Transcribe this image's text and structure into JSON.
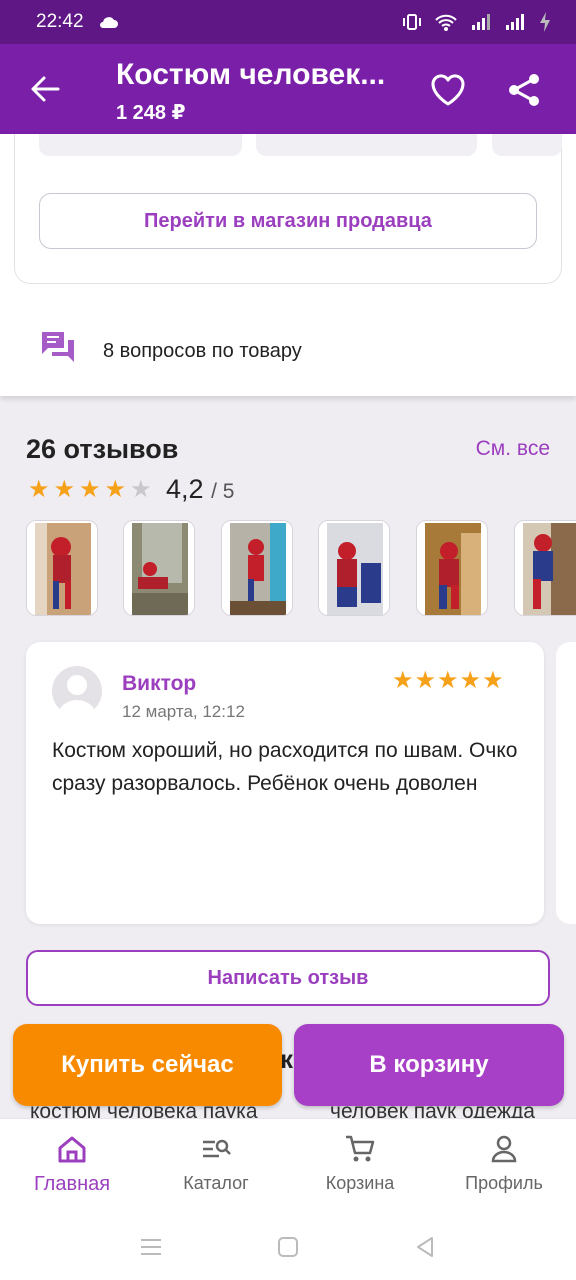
{
  "status_bar": {
    "time": "22:42"
  },
  "app_bar": {
    "title": "Костюм человек...",
    "price": "1 248 ₽"
  },
  "shop": {
    "button_label": "Перейти в магазин продавца"
  },
  "questions": {
    "label": "8 вопросов по товару"
  },
  "reviews": {
    "title": "26 отзывов",
    "see_all": "См. все",
    "rating": "4,2",
    "rating_of": "/ 5",
    "stars_filled": 4,
    "stars_total": 5
  },
  "review": {
    "author": "Виктор",
    "date": "12 марта, 12:12",
    "stars": "★★★★★",
    "text": "Костюм хороший, но расходится по швам. Очко сразу разорвалось. Ребёнок очень доволен"
  },
  "write_review": "Написать отзыв",
  "behind": {
    "left": "костюм человека паука",
    "right": "человек паук одежда",
    "heading_fragment": "к"
  },
  "actions": {
    "buy_now": "Купить сейчас",
    "to_cart": "В корзину"
  },
  "bottom_nav": [
    {
      "label": "Главная",
      "icon": "home-icon",
      "active": true
    },
    {
      "label": "Каталог",
      "icon": "catalog-search-icon",
      "active": false
    },
    {
      "label": "Корзина",
      "icon": "cart-icon",
      "active": false
    },
    {
      "label": "Профиль",
      "icon": "profile-icon",
      "active": false
    }
  ],
  "colors": {
    "brand": "#7a1fa8",
    "accent": "#9b3fbf",
    "orange": "#f88a00",
    "star": "#f6a11a"
  }
}
